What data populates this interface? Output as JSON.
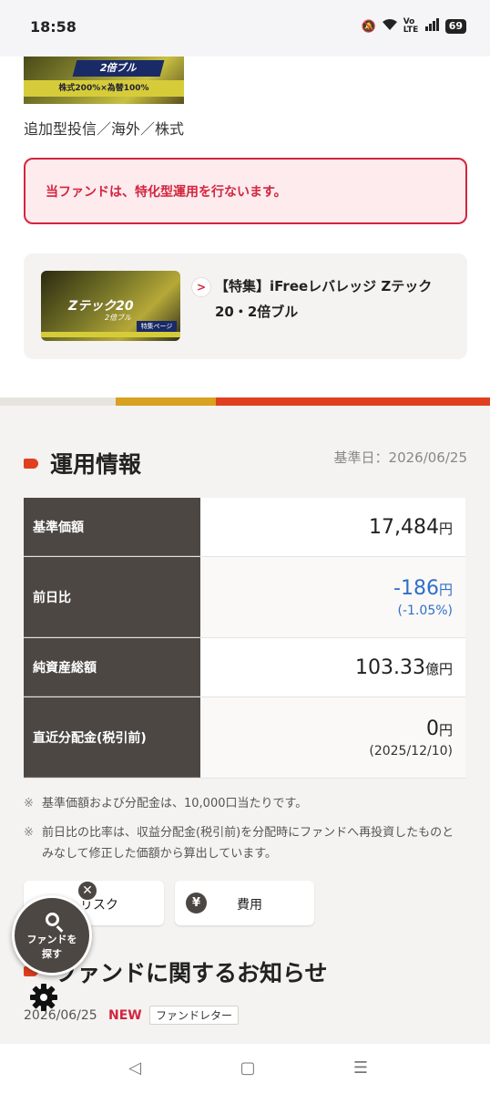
{
  "status_bar": {
    "time": "18:58",
    "network": "Vo LTE",
    "battery": "69"
  },
  "fund": {
    "banner_badge": "2倍ブル",
    "banner_sub": "株式200%×為替100%",
    "category": "追加型投信／海外／株式"
  },
  "notice": {
    "text": "当ファンドは、特化型運用を行ないます。"
  },
  "feature": {
    "thumb_title": "Zテック20",
    "thumb_sub": "2倍ブル",
    "thumb_tag": "特集ページ",
    "title": "【特集】iFreeレバレッジ Zテック20・2倍ブル"
  },
  "operation": {
    "section_title": "運用情報",
    "base_date": "基準日：2026/06/25",
    "rows": [
      {
        "label": "基準価額",
        "value": "17,484",
        "unit": "円"
      },
      {
        "label": "前日比",
        "value": "-186",
        "unit": "円",
        "sub": "(-1.05%)"
      },
      {
        "label": "純資産総額",
        "value": "103.33",
        "unit": "億円"
      },
      {
        "label": "直近分配金(税引前)",
        "value": "0",
        "unit": "円",
        "sub": "(2025/12/10)"
      }
    ],
    "notes": [
      {
        "mark": "※",
        "text": "基準価額および分配金は、10,000口当たりです。"
      },
      {
        "mark": "※",
        "text": "前日比の比率は、収益分配金(税引前)を分配時にファンドへ再投資したものとみなして修正した価額から算出しています。"
      }
    ]
  },
  "tabs": {
    "risk": "リスク",
    "cost": "費用",
    "cost_icon": "¥"
  },
  "news": {
    "section_title": "ファンドに関するお知らせ",
    "date": "2026/06/25",
    "new_label": "NEW",
    "tag": "ファンドレター"
  },
  "fab": {
    "label_line1": "ファンドを",
    "label_line2": "探す",
    "close": "✕"
  },
  "nav": {
    "back": "◁",
    "home": "▢",
    "menu": "☰"
  },
  "colors": {
    "accent_red": "#d3253e",
    "accent_orange": "#e0401f",
    "accent_gold": "#d8a11f",
    "table_header": "#4c4743",
    "negative": "#2f6fc9"
  }
}
